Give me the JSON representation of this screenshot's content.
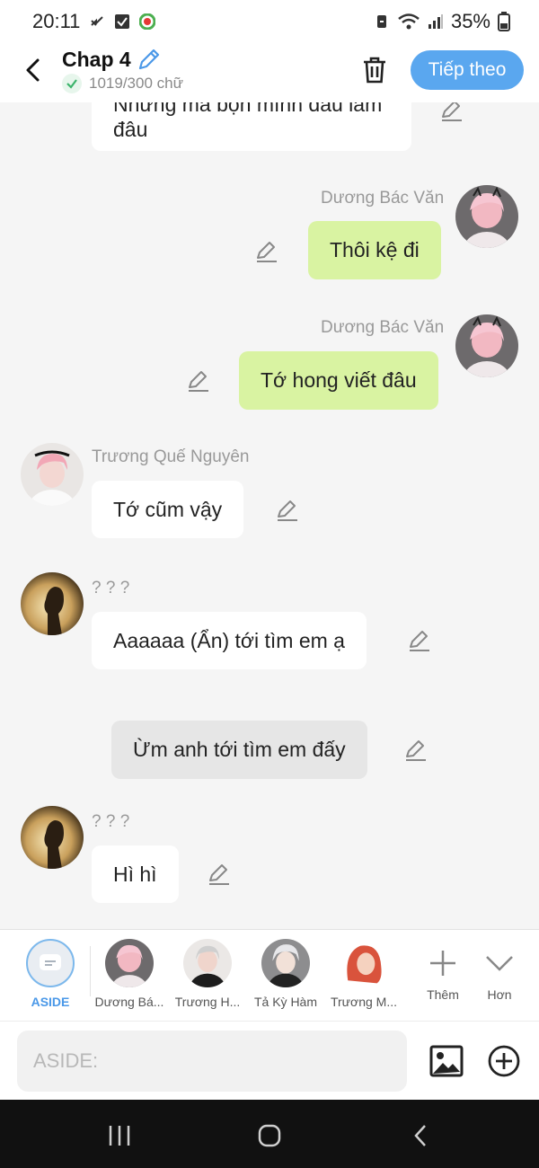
{
  "status_bar": {
    "time": "20:11",
    "battery": "35%"
  },
  "header": {
    "title": "Chap 4",
    "word_count": "1019/300 chữ",
    "next_label": "Tiếp theo"
  },
  "messages": [
    {
      "text": "Nhưng mà bọn mình đâu làm đâu",
      "name": ""
    },
    {
      "name": "Dương Bác Văn",
      "text": "Thôi kệ đi"
    },
    {
      "name": "Dương Bác Văn",
      "text": "Tớ hong viết đâu"
    },
    {
      "name": "Trương Quế Nguyên",
      "text": "Tớ cũm vậy"
    },
    {
      "name": "? ? ?",
      "text": "Aaaaaa (Ẩn) tới tìm em ạ"
    },
    {
      "name": "",
      "text": "Ừm anh tới tìm em đấy"
    },
    {
      "name": "? ? ?",
      "text": "Hì hì"
    }
  ],
  "characters": [
    {
      "label": "ASIDE"
    },
    {
      "label": "Dương Bá..."
    },
    {
      "label": "Trương H..."
    },
    {
      "label": "Tả Kỳ Hàm"
    },
    {
      "label": "Trương M..."
    },
    {
      "label": "Thêm"
    },
    {
      "label": "Hơn"
    }
  ],
  "input": {
    "placeholder": "ASIDE:"
  },
  "colors": {
    "accent": "#5aa7ef",
    "green_bubble": "#d9f3a2",
    "aside_label": "#4a98e8"
  }
}
